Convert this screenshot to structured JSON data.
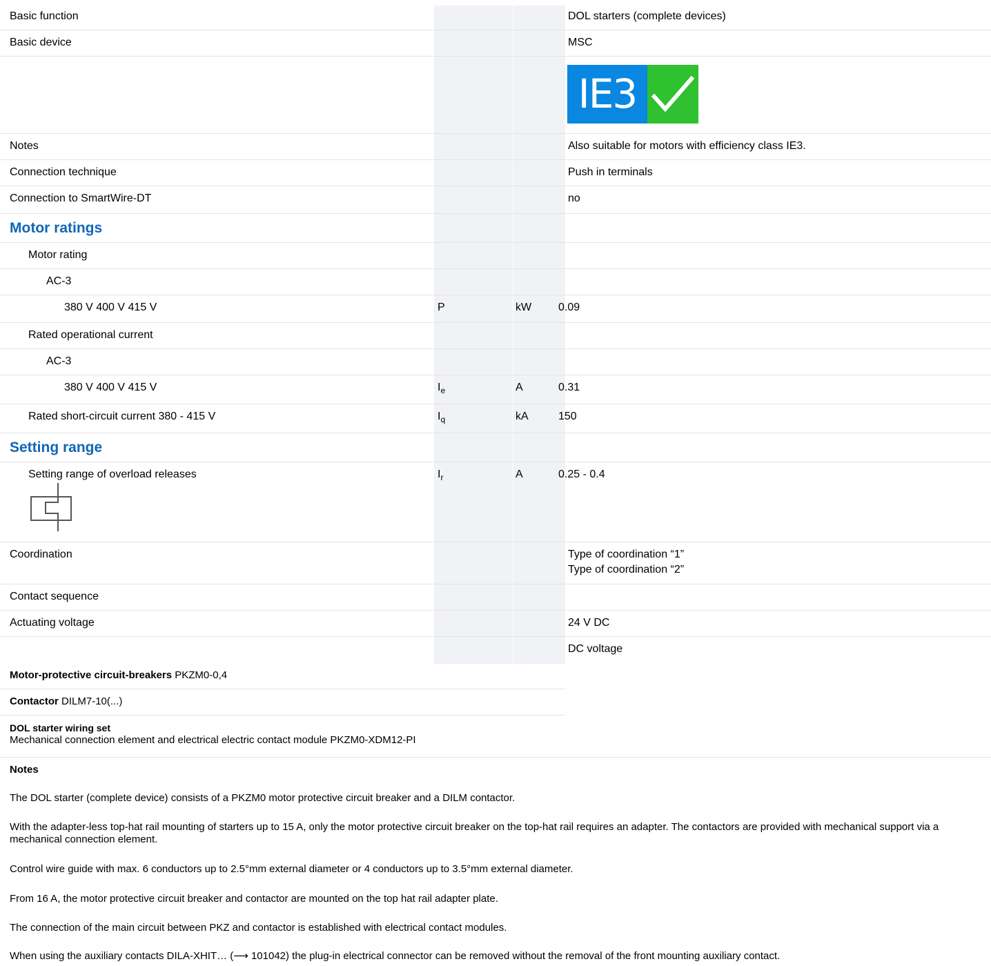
{
  "rows": {
    "basic_function": {
      "label": "Basic function",
      "value": "DOL starters (complete devices)"
    },
    "basic_device": {
      "label": "Basic device",
      "value": "MSC"
    },
    "notes": {
      "label": "Notes",
      "value": "Also suitable for motors with efficiency class IE3."
    },
    "connection_technique": {
      "label": "Connection technique",
      "value": "Push in terminals"
    },
    "connection_smartwire": {
      "label": "Connection to SmartWire-DT",
      "value": "no"
    },
    "coordination": {
      "label": "Coordination",
      "value1": "Type of coordination “1”",
      "value2": "Type of coordination “2”"
    },
    "contact_sequence": {
      "label": "Contact sequence"
    },
    "actuating_voltage": {
      "label": "Actuating voltage",
      "value": "24 V DC",
      "value2": "DC voltage"
    }
  },
  "ie3_badge": {
    "text": "IE3",
    "icon": "checkmark-icon",
    "blue": "#0a87e0",
    "green": "#2fc12f"
  },
  "motor_ratings": {
    "heading": "Motor ratings",
    "motor_rating": "Motor rating",
    "ac3_a": "AC-3",
    "voltage_a": "380 V 400 V 415 V",
    "sym_p": "P",
    "unit_kw": "kW",
    "value_kw": "0.09",
    "rated_current": "Rated operational current",
    "ac3_b": "AC-3",
    "voltage_b": "380 V 400 V 415 V",
    "sym_ie_main": "I",
    "sym_ie_sub": "e",
    "unit_a": "A",
    "value_a": "0.31",
    "short_circuit": "Rated short-circuit current 380 - 415 V",
    "sym_iq_main": "I",
    "sym_iq_sub": "q",
    "unit_ka": "kA",
    "value_ka": "150"
  },
  "setting_range": {
    "heading": "Setting range",
    "label": "Setting range of overload releases",
    "sym_main": "I",
    "sym_sub": "r",
    "unit": "A",
    "value": "0.25 - 0.4",
    "icon": "overload-relay-icon"
  },
  "components": {
    "mpcb_bold": "Motor-protective circuit-breakers",
    "mpcb_value": "PKZM0-0,4",
    "contactor_bold": "Contactor",
    "contactor_value": "DILM7-10(...)",
    "wiring_bold": "DOL starter wiring set",
    "wiring_value": "Mechanical connection element and electrical electric contact module PKZM0-XDM12-PI"
  },
  "notes_section": {
    "heading": "Notes",
    "p1": "The DOL starter (complete device) consists of a PKZM0 motor protective circuit breaker and a DILM contactor.",
    "p2": "With the adapter-less top-hat rail mounting of starters up to 15 A, only the motor protective circuit breaker on the top-hat rail requires an adapter. The contactors are provided with mechanical support via a mechanical connection element.",
    "p3": "Control wire guide with max. 6 conductors up to 2.5°mm external diameter or 4 conductors up to 3.5°mm external diameter.",
    "p4": "From 16 A, the motor protective circuit breaker and contactor are mounted on the top hat rail adapter plate.",
    "p5": "The connection of the main circuit between PKZ and contactor is established with electrical contact modules.",
    "p6": "When using the auxiliary contacts DILA-XHIT… (⟶ 101042) the plug-in electrical connector can be removed without the removal of the front mounting auxiliary contact."
  }
}
